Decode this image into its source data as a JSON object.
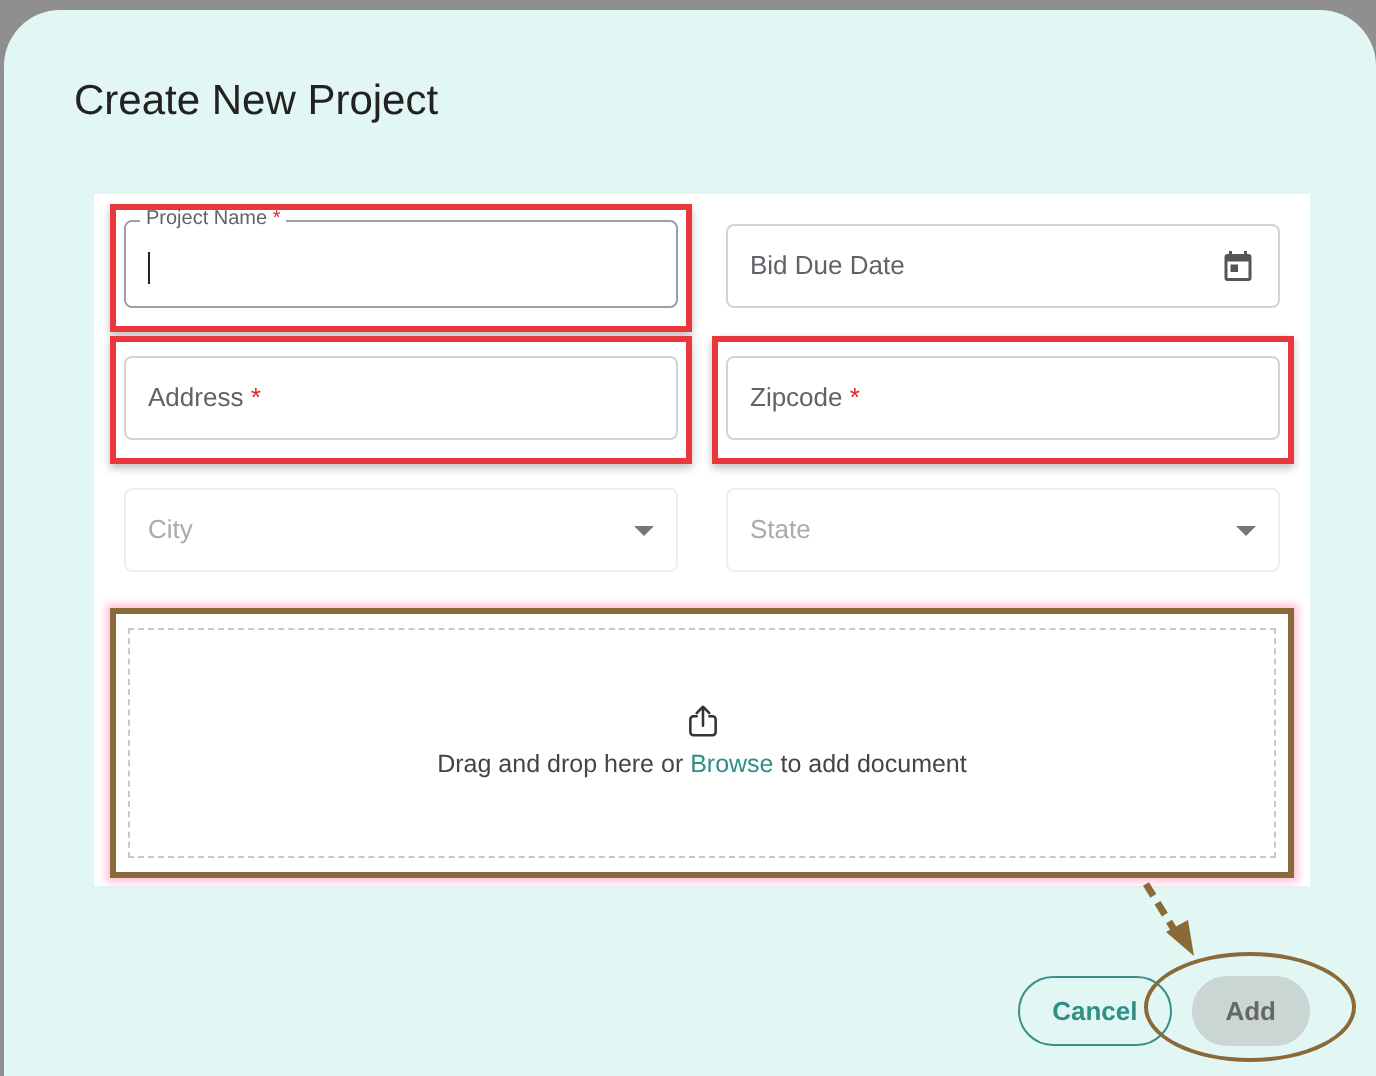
{
  "dialog": {
    "title": "Create New Project"
  },
  "fields": [
    {
      "label": "Project Name",
      "required_mark": "*",
      "kind": "text",
      "focused": true,
      "disabled": false,
      "highlighted": true
    },
    {
      "label": "Bid Due Date",
      "kind": "date",
      "focused": false,
      "disabled": false,
      "highlighted": false
    },
    {
      "label": "Address",
      "required_mark": "*",
      "kind": "text",
      "focused": false,
      "disabled": false,
      "highlighted": true
    },
    {
      "label": "Zipcode",
      "required_mark": "*",
      "kind": "text",
      "focused": false,
      "disabled": false,
      "highlighted": true
    },
    {
      "label": "City",
      "kind": "select",
      "focused": false,
      "disabled": true,
      "highlighted": false
    },
    {
      "label": "State",
      "kind": "select",
      "focused": false,
      "disabled": true,
      "highlighted": false
    }
  ],
  "upload": {
    "text_before": "Drag and drop here or",
    "link": "Browse",
    "text_after": "to add document",
    "highlighted": true
  },
  "buttons": [
    {
      "label": "Cancel",
      "kind": "outline",
      "circled": false
    },
    {
      "label": "Add",
      "kind": "filled",
      "circled": true
    }
  ]
}
